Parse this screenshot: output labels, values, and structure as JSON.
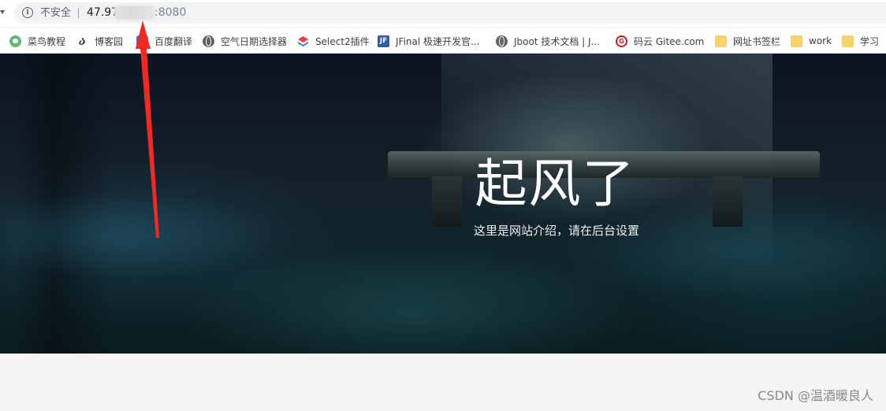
{
  "address_bar": {
    "security_label": "不安全",
    "url_host": "47.97",
    "url_port": ":8080"
  },
  "bookmarks": [
    {
      "label": "菜鸟教程",
      "icon": "runoob-icon"
    },
    {
      "label": "博客园",
      "icon": "cnblogs-icon"
    },
    {
      "label": "百度翻译",
      "icon": "baidu-translate-icon"
    },
    {
      "label": "空气日期选择器",
      "icon": "globe-icon"
    },
    {
      "label": "Select2插件",
      "icon": "select2-icon"
    },
    {
      "label": "JFinal 极速开发官...",
      "icon": "jfinal-icon"
    },
    {
      "label": "Jboot 技术文档 | J...",
      "icon": "globe-icon"
    },
    {
      "label": "码云 Gitee.com",
      "icon": "gitee-icon"
    },
    {
      "label": "网址书签栏",
      "icon": "folder-icon"
    },
    {
      "label": "work",
      "icon": "folder-icon"
    },
    {
      "label": "学习",
      "icon": "folder-icon"
    }
  ],
  "hero": {
    "title": "起风了",
    "subtitle": "这里是网站介绍，请在后台设置"
  },
  "annotation": {
    "color": "#f02a22"
  },
  "watermark": "CSDN @温酒暖良人",
  "colors": {
    "bookmark_folder": "#f6d36b",
    "hero_text": "#ffffff"
  }
}
